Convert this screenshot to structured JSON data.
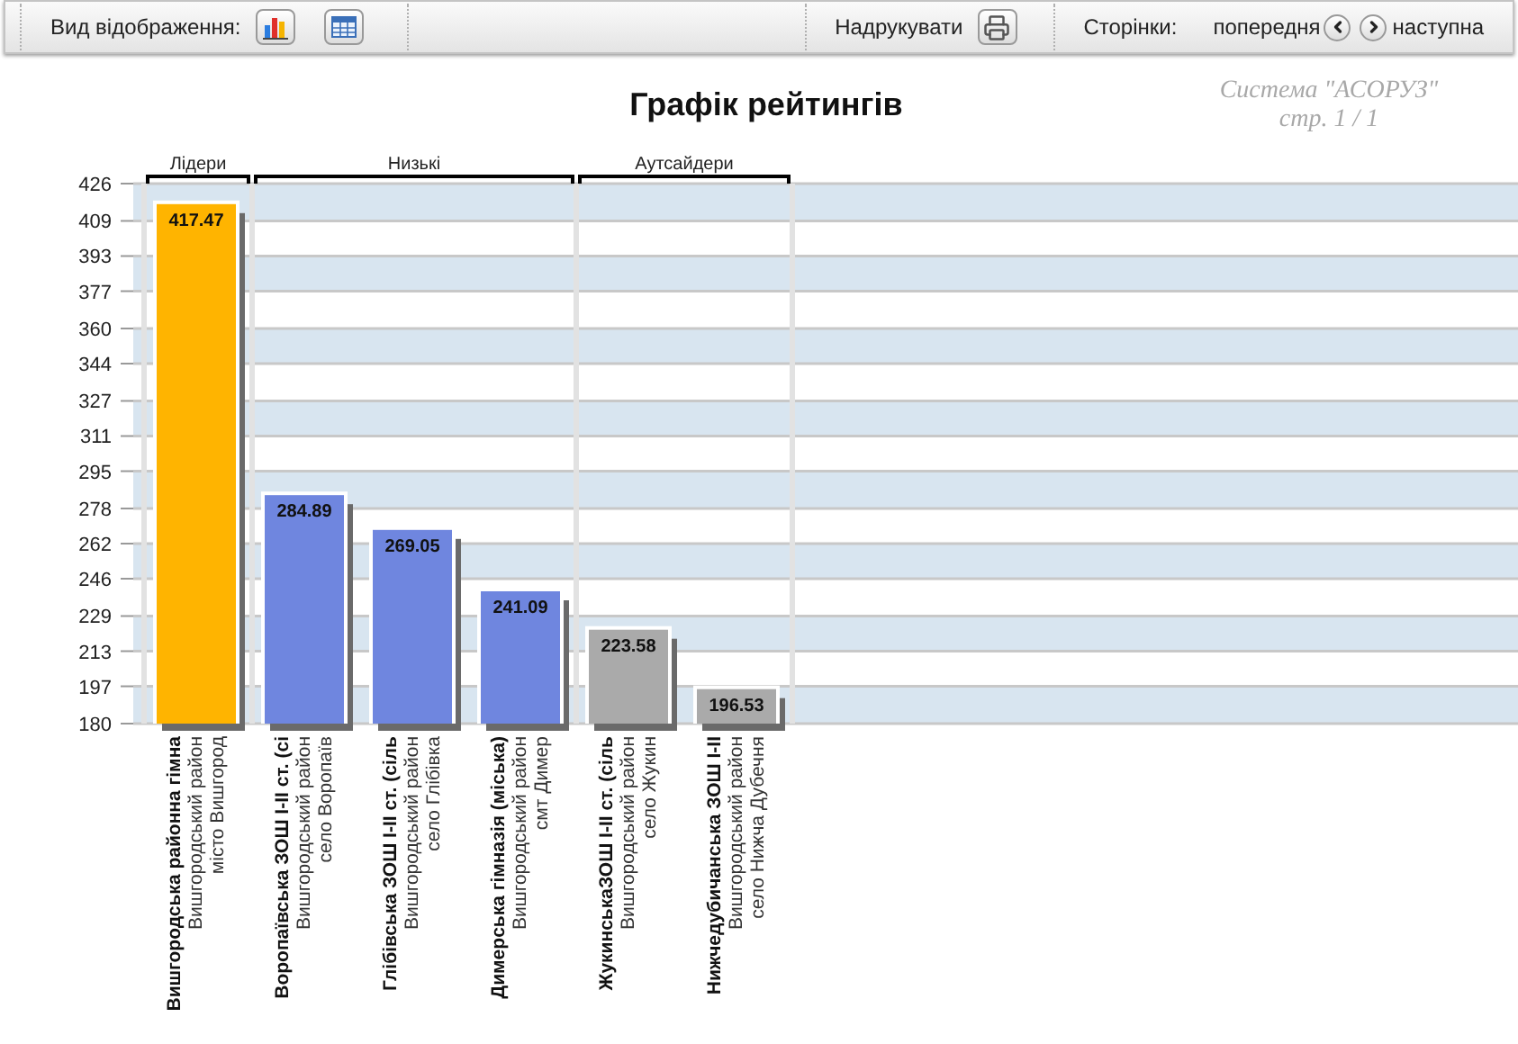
{
  "toolbar": {
    "view_label": "Вид відображення:",
    "print_label": "Надрукувати",
    "pages_label": "Сторінки:",
    "prev_label": "попередня",
    "next_label": "наступна"
  },
  "header": {
    "title": "Графік рейтингів",
    "system": "Система \"АСОРУЗ\"",
    "page": "стр. 1 / 1"
  },
  "chart_data": {
    "type": "bar",
    "stacked": true,
    "grid": true,
    "data_labels": true,
    "ylim": [
      180,
      426
    ],
    "yticks": [
      180,
      197,
      213,
      229,
      246,
      262,
      278,
      295,
      311,
      327,
      344,
      360,
      377,
      393,
      409,
      426
    ],
    "categories": [
      "Вишгородська районна гімна",
      "Воропаївська ЗОШ І-ІІ ст. (сі",
      "Глібівська ЗОШ І-ІІ ст. (сіль",
      "Димерська гімназія (міська)",
      "ЖукинськаЗОШ І-ІІ ст. (сіль",
      "Нижчедубичанська ЗОШ І-ІІ"
    ],
    "series": [
      {
        "color": "#ffb400",
        "values": [
          417.47,
          null,
          null,
          null,
          null,
          null
        ]
      },
      {
        "color": "#6f86df",
        "values": [
          null,
          284.89,
          269.05,
          241.09,
          null,
          null
        ]
      },
      {
        "color": "#aaaaaa",
        "values": [
          null,
          null,
          null,
          null,
          223.58,
          196.53
        ]
      }
    ]
  },
  "group_headers": [
    {
      "label": "Лідери"
    },
    {
      "label": "Низькі"
    },
    {
      "label": "Аутсайдери"
    }
  ],
  "category_details": [
    {
      "district": "Вишгородський район",
      "town": "місто Вишгород"
    },
    {
      "district": "Вишгородський район",
      "town": "село Воропаїв"
    },
    {
      "district": "Вишгородський район",
      "town": "село Глібівка"
    },
    {
      "district": "Вишгородський район",
      "town": "смт Димер"
    },
    {
      "district": "Вишгородський район",
      "town": "село Жукин"
    },
    {
      "district": "Вишгородський район",
      "town": "село Нижча Дубечня"
    }
  ]
}
